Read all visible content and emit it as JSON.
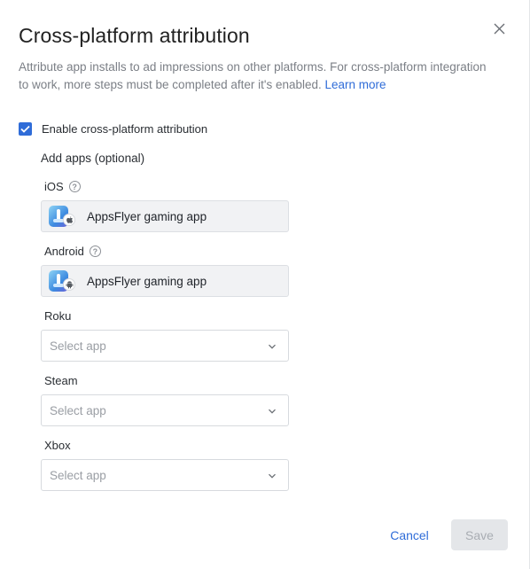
{
  "dialog": {
    "title": "Cross-platform attribution",
    "description": "Attribute app installs to ad impressions on other platforms. For cross-platform integration to work, more steps must be completed after it's enabled.",
    "learn_more": "Learn more",
    "close_icon": "close-icon"
  },
  "enable": {
    "label": "Enable cross-platform attribution",
    "checked": true
  },
  "add_apps_label": "Add apps (optional)",
  "platforms": {
    "ios": {
      "label": "iOS",
      "app_name": "AppsFlyer gaming app",
      "badge_icon": "apple-icon"
    },
    "android": {
      "label": "Android",
      "app_name": "AppsFlyer gaming app",
      "badge_icon": "android-icon"
    },
    "roku": {
      "label": "Roku",
      "placeholder": "Select app"
    },
    "steam": {
      "label": "Steam",
      "placeholder": "Select app"
    },
    "xbox": {
      "label": "Xbox",
      "placeholder": "Select app"
    }
  },
  "help_glyph": "?",
  "footer": {
    "cancel_label": "Cancel",
    "save_label": "Save"
  },
  "colors": {
    "accent": "#2f6cd8",
    "save_disabled_bg": "#e4e6e9",
    "save_disabled_text": "#a9adb3"
  }
}
